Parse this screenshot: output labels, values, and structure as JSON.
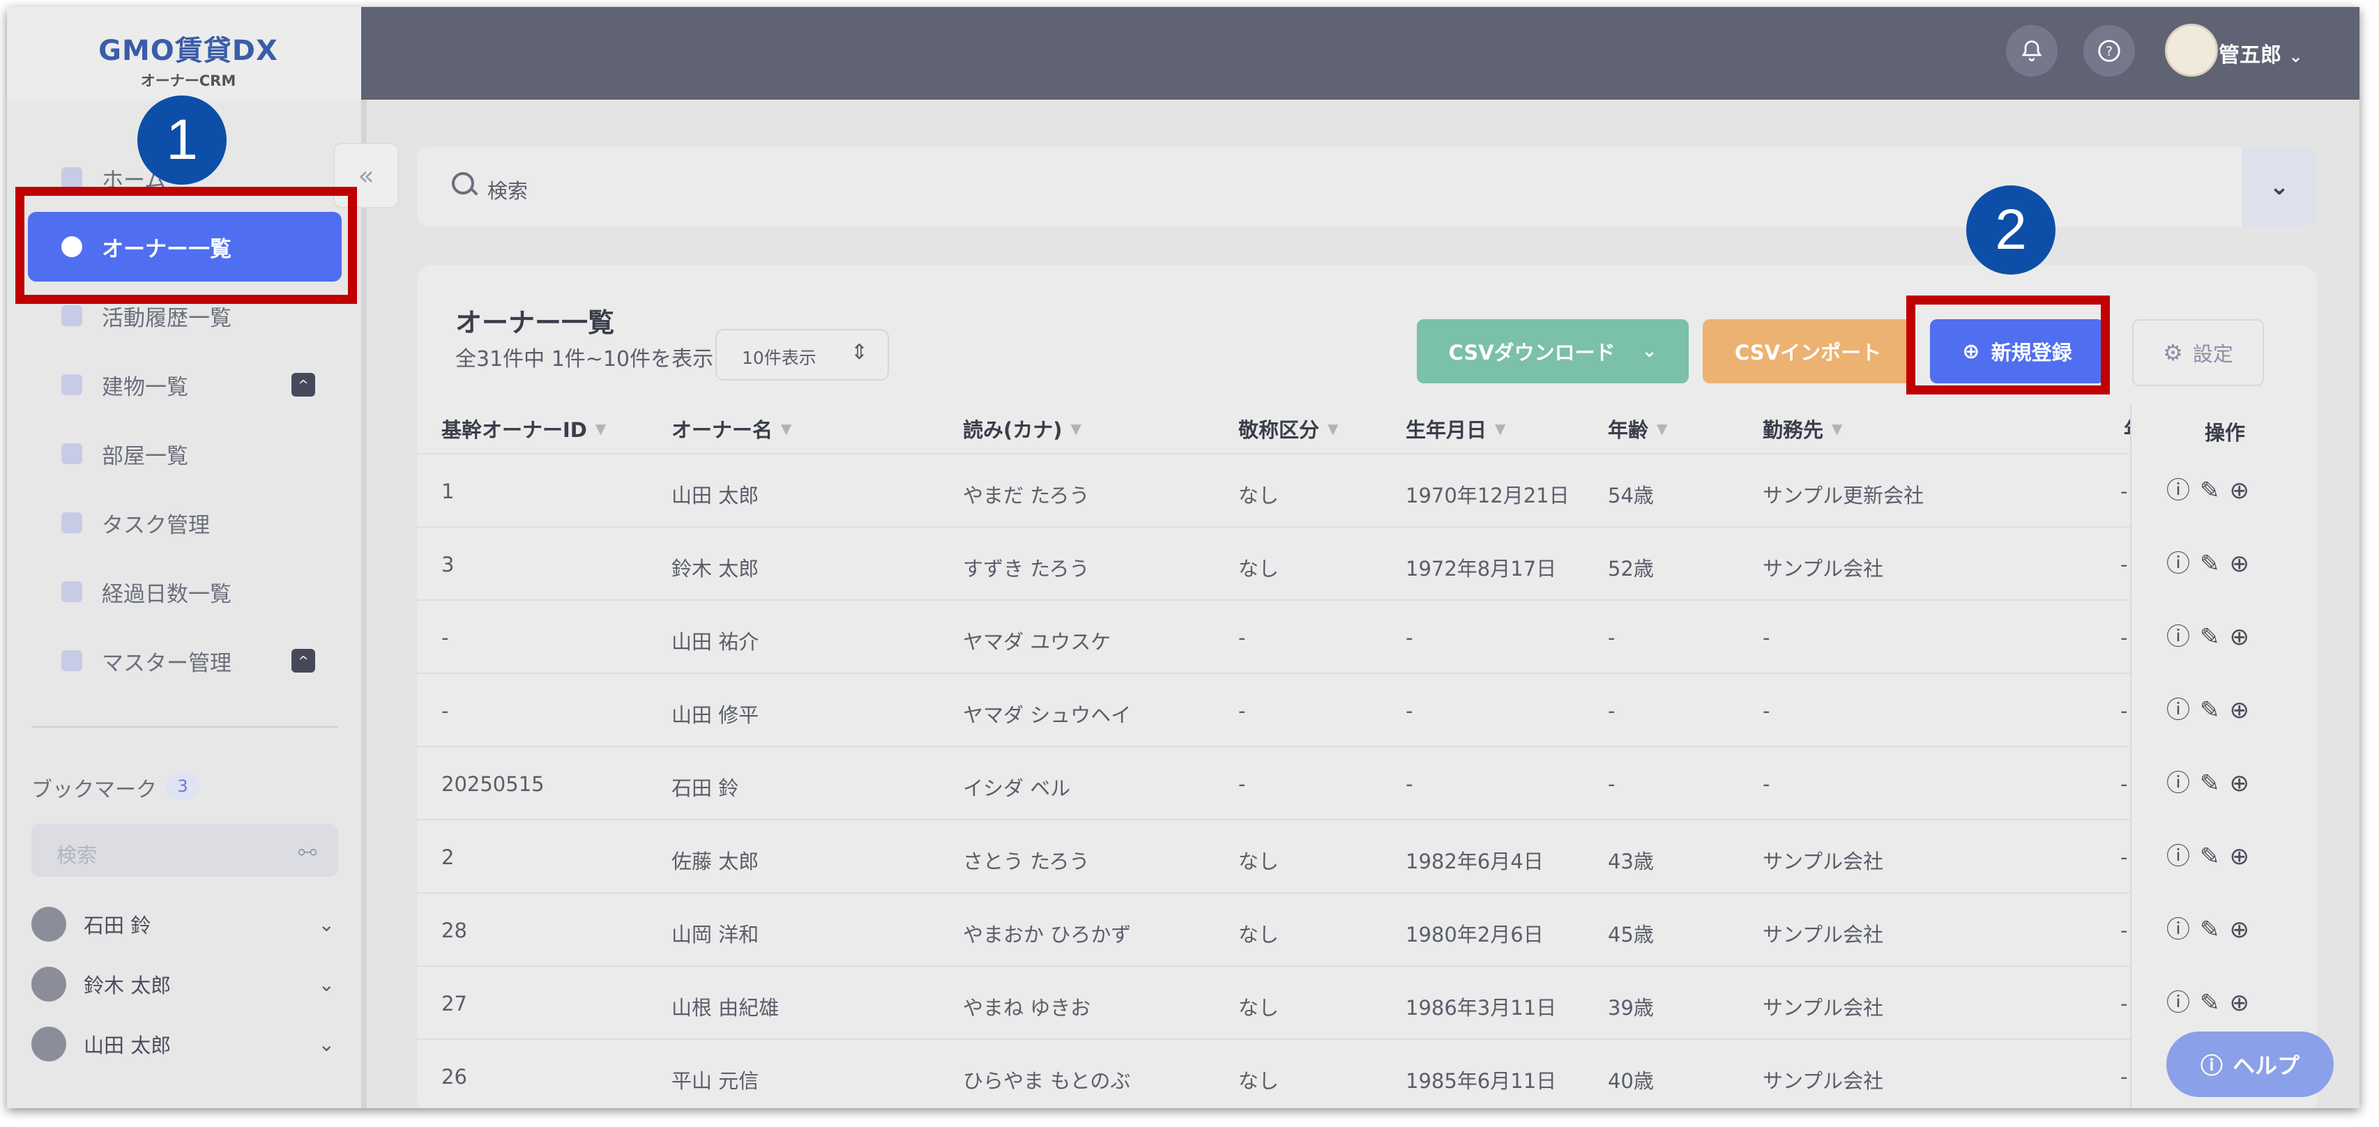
{
  "header": {
    "logo_main": "GMO賃貸DX",
    "logo_sub": "オーナーCRM",
    "user_name": "管五郎",
    "icons": [
      "bell-icon",
      "help-circle-icon",
      "chevron-down-icon"
    ]
  },
  "sidebar": {
    "items": [
      {
        "label": "ホーム",
        "icon": "home-grid-icon"
      },
      {
        "label": "オーナー一覧",
        "icon": "user-circle-icon",
        "active": true
      },
      {
        "label": "活動履歴一覧",
        "icon": "document-icon"
      },
      {
        "label": "建物一覧",
        "icon": "building-icon",
        "badge": "^"
      },
      {
        "label": "部屋一覧",
        "icon": "room-icon"
      },
      {
        "label": "タスク管理",
        "icon": "task-icon"
      },
      {
        "label": "経過日数一覧",
        "icon": "checklist-icon"
      },
      {
        "label": "マスター管理",
        "icon": "settings-gear-icon",
        "badge": "^"
      }
    ],
    "collapse_glyph": "«",
    "bookmarks": {
      "title": "ブックマーク",
      "count": "3",
      "search_placeholder": "検索",
      "items": [
        {
          "label": "石田 鈴"
        },
        {
          "label": "鈴木 太郎"
        },
        {
          "label": "山田 太郎"
        }
      ]
    }
  },
  "annotations": {
    "callout1": "1",
    "callout2": "2"
  },
  "search": {
    "placeholder": "検索"
  },
  "list": {
    "title": "オーナー一覧",
    "summary": "全31件中 1件~10件を表示",
    "page_size": "10件表示",
    "buttons": {
      "csv_download": "CSVダウンロード",
      "csv_import": "CSVインポート",
      "new": "新規登録",
      "settings": "設定"
    },
    "columns": [
      "基幹オーナーID",
      "オーナー名",
      "読み(カナ)",
      "敬称区分",
      "生年月日",
      "年齢",
      "勤務先",
      "年"
    ],
    "ops_label": "操作",
    "rows": [
      {
        "id": "1",
        "name": "山田 太郎",
        "kana": "やまだ たろう",
        "honorific": "なし",
        "birth": "1970年12月21日",
        "age": "54歳",
        "work": "サンプル更新会社",
        "extra": "-"
      },
      {
        "id": "3",
        "name": "鈴木 太郎",
        "kana": "すずき たろう",
        "honorific": "なし",
        "birth": "1972年8月17日",
        "age": "52歳",
        "work": "サンプル会社",
        "extra": "-"
      },
      {
        "id": "-",
        "name": "山田 祐介",
        "kana": "ヤマダ ユウスケ",
        "honorific": "-",
        "birth": "-",
        "age": "-",
        "work": "-",
        "extra": "-"
      },
      {
        "id": "-",
        "name": "山田 修平",
        "kana": "ヤマダ シュウヘイ",
        "honorific": "-",
        "birth": "-",
        "age": "-",
        "work": "-",
        "extra": "-"
      },
      {
        "id": "20250515",
        "name": "石田 鈴",
        "kana": "イシダ ベル",
        "honorific": "-",
        "birth": "-",
        "age": "-",
        "work": "-",
        "extra": "-"
      },
      {
        "id": "2",
        "name": "佐藤 太郎",
        "kana": "さとう たろう",
        "honorific": "なし",
        "birth": "1982年6月4日",
        "age": "43歳",
        "work": "サンプル会社",
        "extra": "-"
      },
      {
        "id": "28",
        "name": "山岡 洋和",
        "kana": "やまおか ひろかず",
        "honorific": "なし",
        "birth": "1980年2月6日",
        "age": "45歳",
        "work": "サンプル会社",
        "extra": "-"
      },
      {
        "id": "27",
        "name": "山根 由紀雄",
        "kana": "やまね ゆきお",
        "honorific": "なし",
        "birth": "1986年3月11日",
        "age": "39歳",
        "work": "サンプル会社",
        "extra": "-"
      },
      {
        "id": "26",
        "name": "平山 元信",
        "kana": "ひらやま もとのぶ",
        "honorific": "なし",
        "birth": "1985年6月11日",
        "age": "40歳",
        "work": "サンプル会社",
        "extra": "-"
      }
    ]
  },
  "help": {
    "label": "ヘルプ"
  },
  "colors": {
    "header": "#5f6373",
    "accent": "#4f6ff0",
    "csv_download": "#7bc0a8",
    "csv_import": "#ecb271",
    "highlight": "#c00000",
    "callout": "#0d4fa8"
  }
}
